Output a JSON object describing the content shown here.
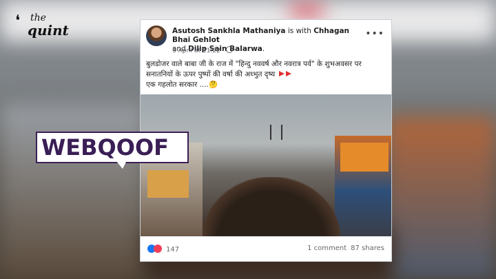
{
  "brand": {
    "logo_the": "the",
    "logo_quint": "quint"
  },
  "tag": {
    "label": "WEBQOOF"
  },
  "post": {
    "author": "Asutosh Sankhla Mathaniya",
    "with_text": " is with ",
    "tagged_1": "Chhagan Bhai Gehlot",
    "and_text": " and ",
    "tagged_2": "Dilip Sain Balarwa",
    "period": ".",
    "timestamp": "3 April at 11:22 ·",
    "more_icon": "more-horizontal-icon",
    "line1": "बुलडोजर वाले बाबा जी के राज में \"हिन्दु नववर्ष और नवरात्र पर्व\" के शुभअवसर पर",
    "line2": "सनातनियों के ऊपर पुष्पों की वर्षा की अध्भुत दृष्य",
    "line3": "एक गहलोत सरकार ....🤔",
    "reactions_count": "147",
    "comments": "1 comment",
    "shares": "87 shares"
  },
  "colors": {
    "tag_purple": "#3a1e55",
    "fb_blue": "#1877f2",
    "love_red": "#f33e58"
  }
}
